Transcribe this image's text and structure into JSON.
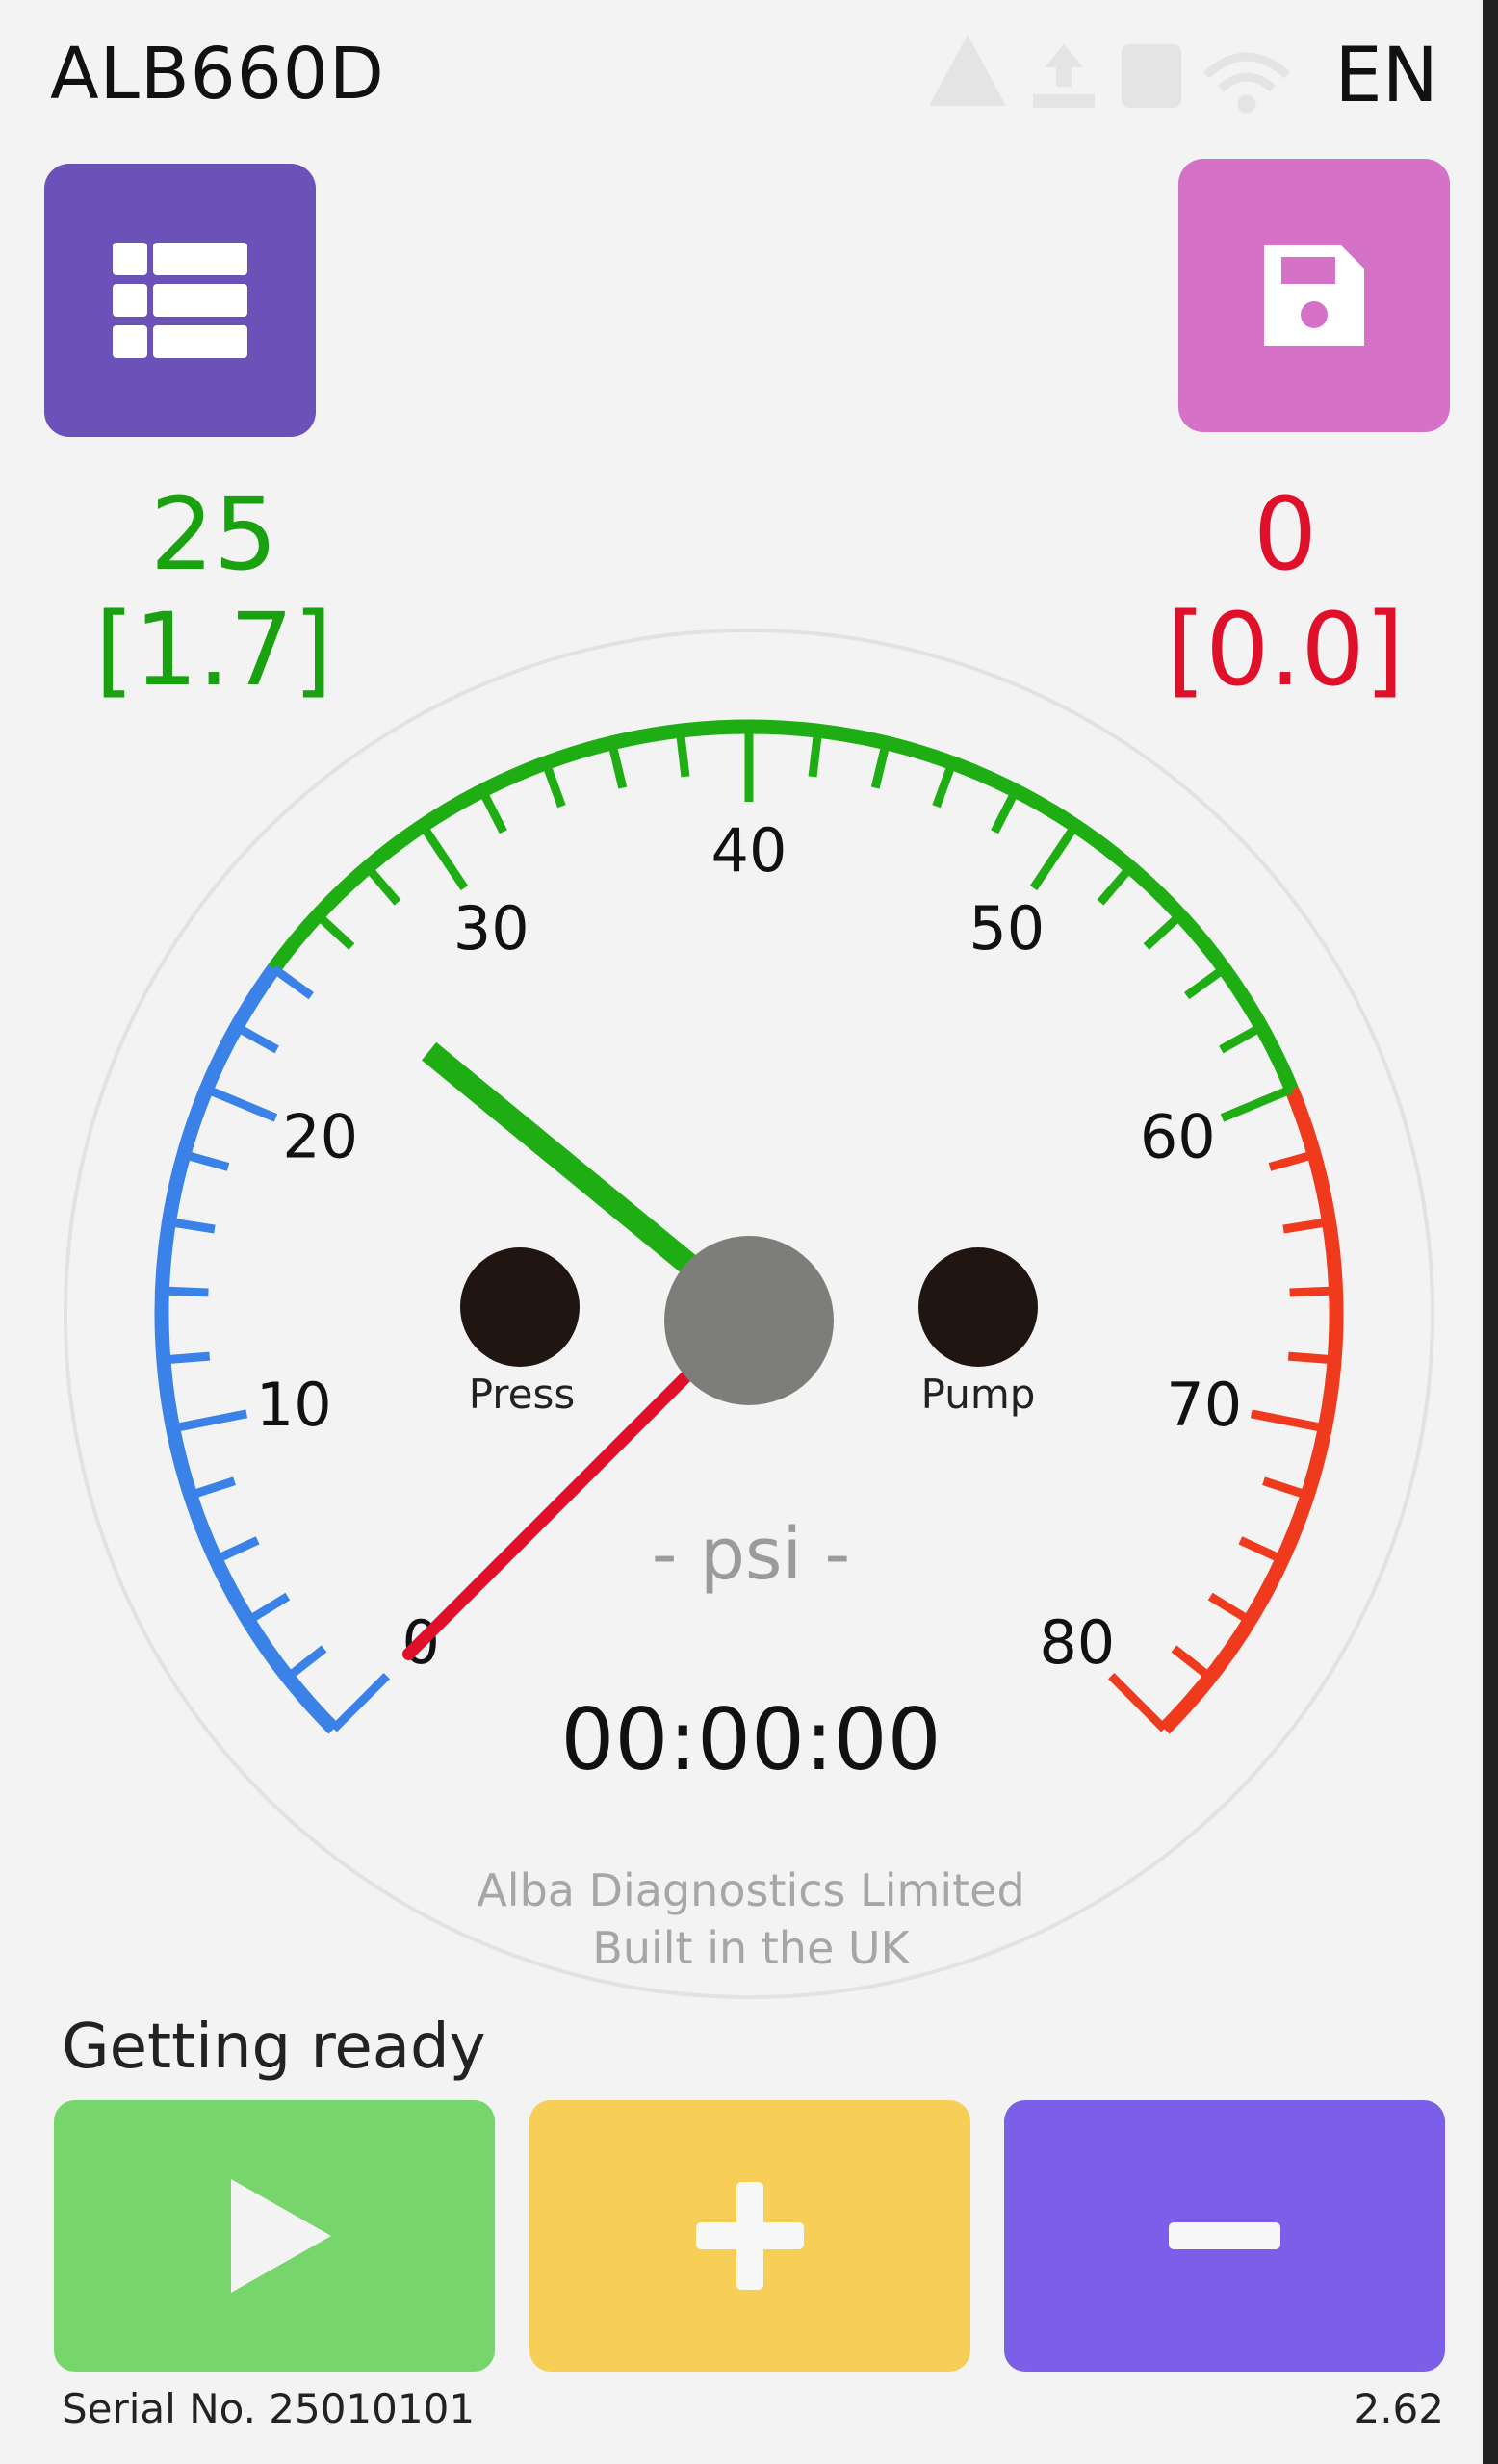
{
  "header": {
    "model": "ALB660D",
    "language": "EN",
    "status_icons": [
      "warning-icon",
      "upload-icon",
      "storage-icon",
      "wifi-icon"
    ]
  },
  "buttons": {
    "menu_icon": "list-icon",
    "save_icon": "save-icon",
    "start_icon": "play-icon",
    "increase_icon": "plus-icon",
    "decrease_icon": "minus-icon"
  },
  "readings": {
    "left_value": "25",
    "left_sub": "[1.7]",
    "right_value": "0",
    "right_sub": "[0.0]"
  },
  "gauge": {
    "unit_label": "- psi -",
    "timer": "00:00:00",
    "min": 0,
    "max": 80,
    "major_ticks": [
      "0",
      "10",
      "20",
      "30",
      "40",
      "50",
      "60",
      "70",
      "80"
    ],
    "green_needle_value": 25,
    "red_needle_value": 0,
    "bands": [
      {
        "from": 0,
        "to": 24,
        "color": "#3b82e8"
      },
      {
        "from": 24,
        "to": 60,
        "color": "#1fad14"
      },
      {
        "from": 60,
        "to": 80,
        "color": "#ef3a1e"
      }
    ],
    "indicators": {
      "left_label": "Press",
      "right_label": "Pump"
    },
    "footer_line1": "Alba Diagnostics Limited",
    "footer_line2": "Built in the UK"
  },
  "status": {
    "text": "Getting ready"
  },
  "footer": {
    "serial": "Serial No. 25010101",
    "version": "2.62"
  },
  "colors": {
    "menu_button": "#6c52b8",
    "save_button": "#d571c7",
    "start_button": "#77d66b",
    "plus_button": "#f7cf57",
    "minus_button": "#7b5fe8",
    "green_needle": "#1fad14",
    "red_needle": "#e0102a"
  }
}
